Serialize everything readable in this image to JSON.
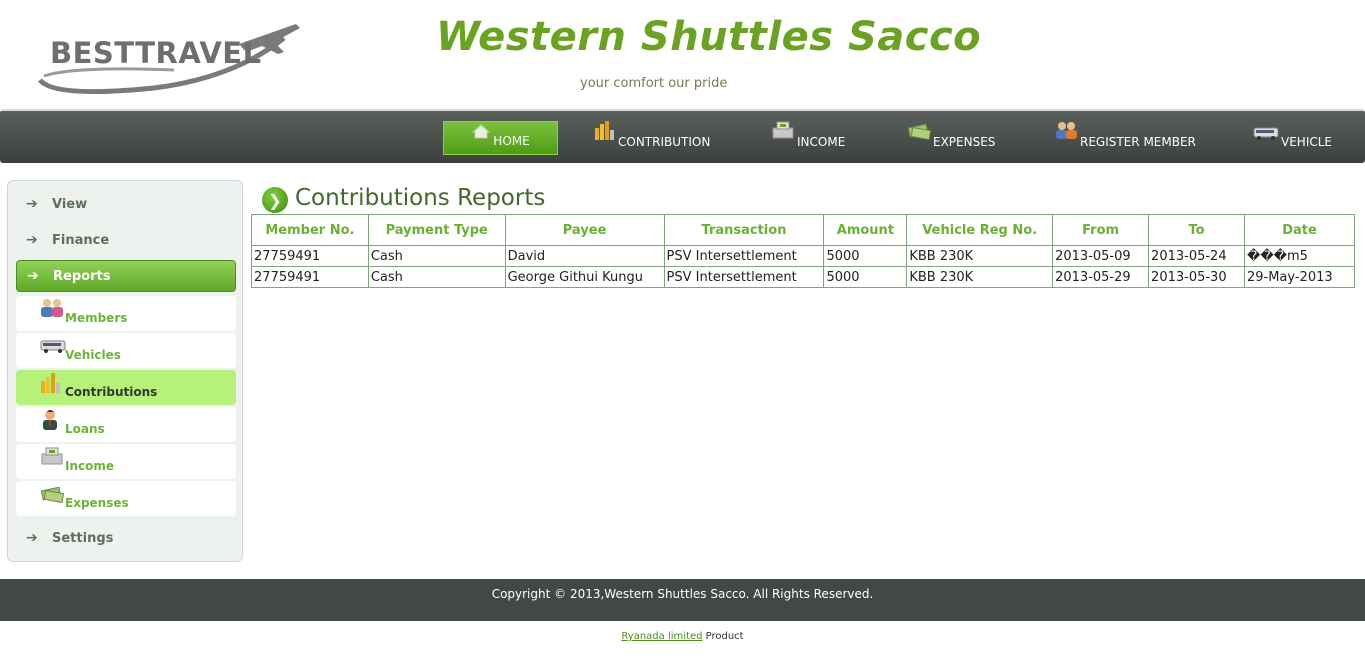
{
  "header": {
    "logo_text": "BESTTRAVEL",
    "site_title": "Western Shuttles Sacco",
    "tagline": "your comfort our pride"
  },
  "nav": {
    "items": [
      {
        "label": "HOME",
        "icon": "home-icon",
        "active": true
      },
      {
        "label": "CONTRIBUTION",
        "icon": "bar-chart-icon"
      },
      {
        "label": "INCOME",
        "icon": "cash-register-icon"
      },
      {
        "label": "EXPENSES",
        "icon": "money-icon"
      },
      {
        "label": "REGISTER MEMBER",
        "icon": "users-icon"
      },
      {
        "label": "VEHICLE",
        "icon": "bus-icon"
      }
    ]
  },
  "sidebar": {
    "sections": [
      {
        "label": "View"
      },
      {
        "label": "Finance"
      },
      {
        "label": "Reports",
        "active": true
      },
      {
        "label": "Settings"
      }
    ],
    "report_items": [
      {
        "label": "Members",
        "icon": "members-icon"
      },
      {
        "label": "Vehicles",
        "icon": "bus-icon"
      },
      {
        "label": "Contributions",
        "icon": "bar-chart-icon",
        "active": true
      },
      {
        "label": "Loans",
        "icon": "person-icon"
      },
      {
        "label": "Income",
        "icon": "cash-register-icon"
      },
      {
        "label": "Expenses",
        "icon": "money-icon"
      }
    ]
  },
  "main": {
    "title": "Contributions Reports",
    "columns": [
      "Member No.",
      "Payment Type",
      "Payee",
      "Transaction",
      "Amount",
      "Vehicle Reg No.",
      "From",
      "To",
      "Date"
    ],
    "rows": [
      [
        "27759491",
        "Cash",
        "David",
        "PSV Intersettlement",
        "5000",
        "KBB 230K",
        "2013-05-09",
        "2013-05-24",
        "���m5"
      ],
      [
        "27759491",
        "Cash",
        "George Githui Kungu",
        "PSV Intersettlement",
        "5000",
        "KBB 230K",
        "2013-05-29",
        "2013-05-30",
        "29-May-2013"
      ]
    ]
  },
  "footer": {
    "copyright": "Copyright © 2013,Western Shuttles Sacco. All Rights Reserved.",
    "credit_link": "Ryanada limited",
    "credit_suffix": " Product"
  },
  "colors": {
    "brand_green": "#6aa321",
    "nav_dark": "#444844",
    "active_green": "#5fa92a",
    "active_light": "#b6f17a"
  }
}
